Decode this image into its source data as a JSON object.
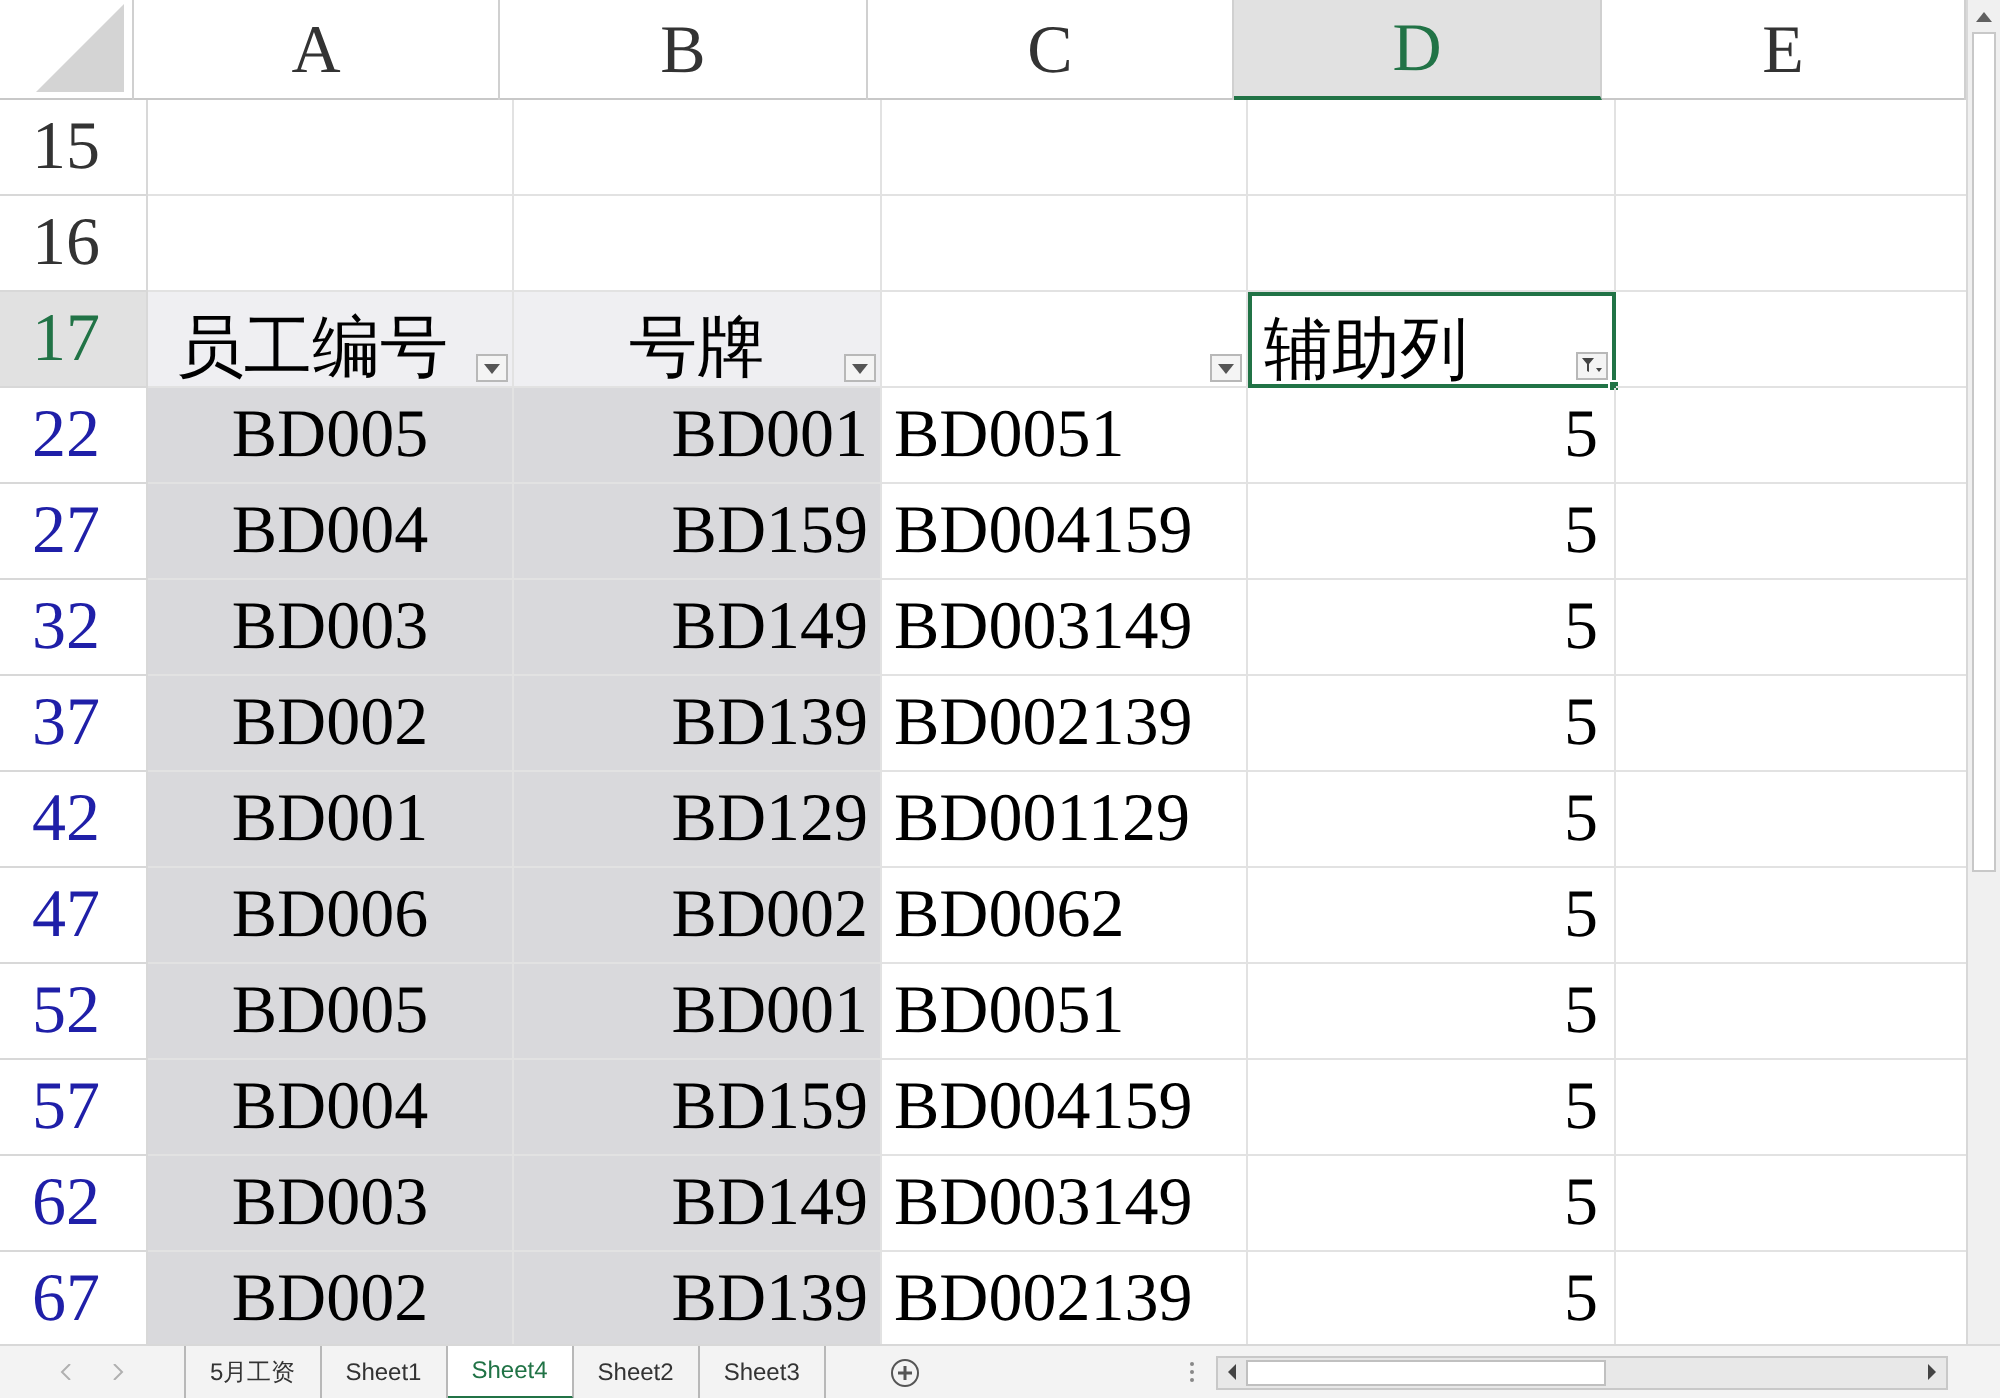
{
  "columns": [
    {
      "label": "A",
      "selected": false,
      "shaded": true
    },
    {
      "label": "B",
      "selected": false,
      "shaded": true
    },
    {
      "label": "C",
      "selected": false,
      "shaded": false
    },
    {
      "label": "D",
      "selected": true,
      "shaded": false
    },
    {
      "label": "E",
      "selected": false,
      "shaded": false
    }
  ],
  "rows": [
    {
      "number": "15",
      "kind": "empty",
      "selected": false,
      "filtered": false,
      "cells": [
        "",
        "",
        "",
        "",
        ""
      ]
    },
    {
      "number": "16",
      "kind": "empty",
      "selected": false,
      "filtered": false,
      "cells": [
        "",
        "",
        "",
        "",
        ""
      ]
    },
    {
      "number": "17",
      "kind": "header",
      "selected": true,
      "cells": [
        {
          "text": "员工编号",
          "filter": true,
          "filter_applied": false,
          "active": false
        },
        {
          "text": "号牌",
          "filter": true,
          "filter_applied": false,
          "active": false
        },
        {
          "filter": true,
          "filter_applied": false,
          "active": false
        },
        {
          "text": "辅助列",
          "filter": true,
          "filter_applied": true,
          "active": true
        },
        {
          "filter": false,
          "active": false
        }
      ]
    },
    {
      "number": "22",
      "kind": "data",
      "selected": false,
      "filtered": true,
      "cells": [
        "BD005",
        "BD001",
        "BD0051",
        "5",
        ""
      ]
    },
    {
      "number": "27",
      "kind": "data",
      "selected": false,
      "filtered": true,
      "cells": [
        "BD004",
        "BD159",
        "BD004159",
        "5",
        ""
      ]
    },
    {
      "number": "32",
      "kind": "data",
      "selected": false,
      "filtered": true,
      "cells": [
        "BD003",
        "BD149",
        "BD003149",
        "5",
        ""
      ]
    },
    {
      "number": "37",
      "kind": "data",
      "selected": false,
      "filtered": true,
      "cells": [
        "BD002",
        "BD139",
        "BD002139",
        "5",
        ""
      ]
    },
    {
      "number": "42",
      "kind": "data",
      "selected": false,
      "filtered": true,
      "cells": [
        "BD001",
        "BD129",
        "BD001129",
        "5",
        ""
      ]
    },
    {
      "number": "47",
      "kind": "data",
      "selected": false,
      "filtered": true,
      "cells": [
        "BD006",
        "BD002",
        "BD0062",
        "5",
        ""
      ]
    },
    {
      "number": "52",
      "kind": "data",
      "selected": false,
      "filtered": true,
      "cells": [
        "BD005",
        "BD001",
        "BD0051",
        "5",
        ""
      ]
    },
    {
      "number": "57",
      "kind": "data",
      "selected": false,
      "filtered": true,
      "cells": [
        "BD004",
        "BD159",
        "BD004159",
        "5",
        ""
      ]
    },
    {
      "number": "62",
      "kind": "data",
      "selected": false,
      "filtered": true,
      "cells": [
        "BD003",
        "BD149",
        "BD003149",
        "5",
        ""
      ]
    },
    {
      "number": "67",
      "kind": "data",
      "selected": false,
      "filtered": true,
      "cells": [
        "BD002",
        "BD139",
        "BD002139",
        "5",
        ""
      ]
    }
  ],
  "sheet_tabs": [
    {
      "label": "5月工资",
      "selected": false
    },
    {
      "label": "Sheet1",
      "selected": false
    },
    {
      "label": "Sheet4",
      "selected": true
    },
    {
      "label": "Sheet2",
      "selected": false
    },
    {
      "label": "Sheet3",
      "selected": false
    }
  ]
}
